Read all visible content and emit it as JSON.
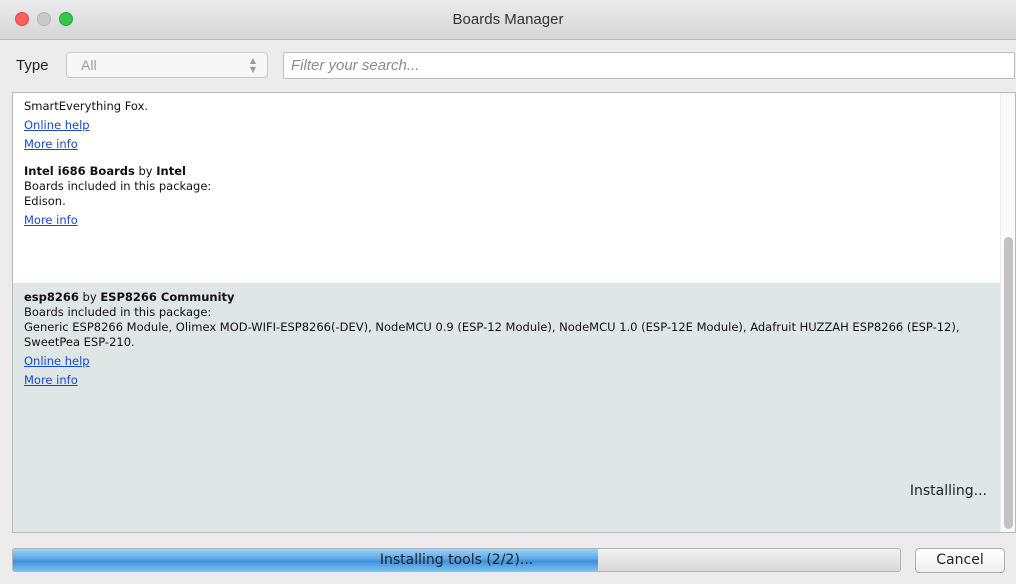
{
  "window": {
    "title": "Boards Manager"
  },
  "filter": {
    "type_label": "Type",
    "type_value": "All",
    "search_placeholder": "Filter your search..."
  },
  "entries": [
    {
      "partial_text": "SmartEverything Fox.",
      "online_help": "Online help",
      "more_info": "More info"
    },
    {
      "name": "Intel i686 Boards",
      "by": "by",
      "author": "Intel",
      "boards_heading": "Boards included in this package:",
      "boards": "Edison.",
      "more_info": "More info"
    },
    {
      "name": "esp8266",
      "by": "by",
      "author": "ESP8266 Community",
      "boards_heading": "Boards included in this package:",
      "boards": "Generic ESP8266 Module, Olimex MOD-WIFI-ESP8266(-DEV), NodeMCU 0.9 (ESP-12 Module), NodeMCU 1.0 (ESP-12E Module), Adafruit HUZZAH ESP8266 (ESP-12), SweetPea ESP-210.",
      "online_help": "Online help",
      "more_info": "More info",
      "status": "Installing..."
    }
  ],
  "footer": {
    "progress_text": "Installing tools (2/2)...",
    "progress_fraction": 0.66,
    "cancel_label": "Cancel"
  },
  "colors": {
    "link": "#1a46c9",
    "selected_row": "#dfe6e6",
    "progress_fill": "#5aa8ea"
  }
}
